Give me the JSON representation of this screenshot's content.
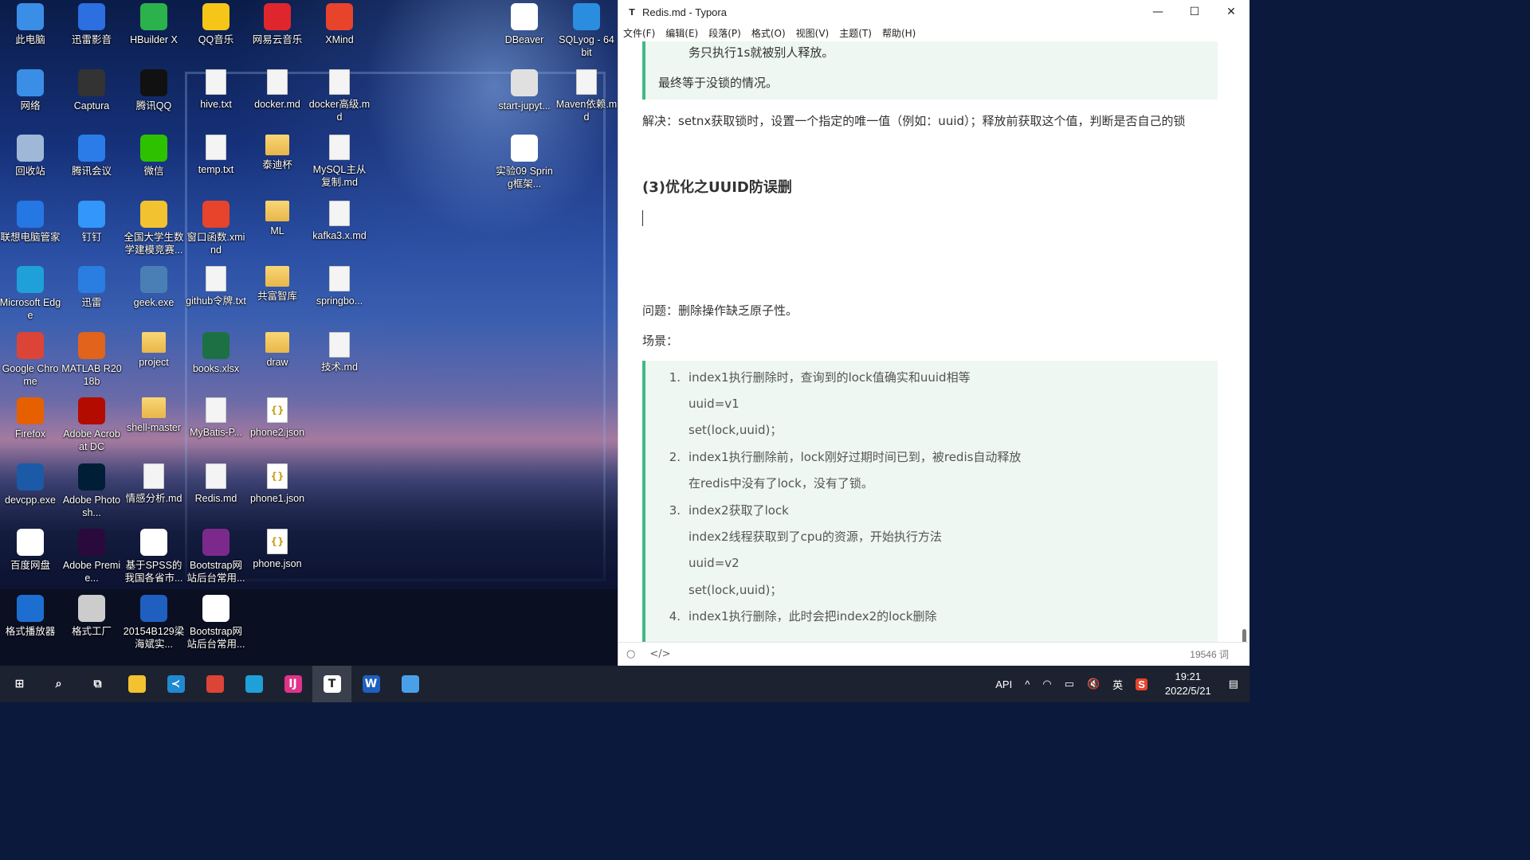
{
  "desktop_icons": [
    {
      "label": "此电脑",
      "kind": "pc-icon",
      "color": "#3a8ee6"
    },
    {
      "label": "迅雷影音",
      "kind": "player-icon",
      "color": "#2b6fe0"
    },
    {
      "label": "HBuilder X",
      "kind": "hbuilder-icon",
      "color": "#2bb24c"
    },
    {
      "label": "QQ音乐",
      "kind": "qqmusic-icon",
      "color": "#f5c518"
    },
    {
      "label": "网易云音乐",
      "kind": "netease-icon",
      "color": "#e0262d"
    },
    {
      "label": "XMind",
      "kind": "xmind-icon",
      "color": "#e8432b"
    },
    {
      "label": "DBeaver",
      "kind": "dbeaver-icon",
      "color": "#ffffff"
    },
    {
      "label": "SQLyog - 64 bit",
      "kind": "sqlyog-icon",
      "color": "#2b8de0"
    },
    {
      "label": "网络",
      "kind": "network-icon",
      "color": "#3a8ee6"
    },
    {
      "label": "Captura",
      "kind": "captura-icon",
      "color": "#333333"
    },
    {
      "label": "腾讯QQ",
      "kind": "qq-icon",
      "color": "#111111"
    },
    {
      "label": "hive.txt",
      "kind": "file-icon",
      "color": "#f4f4f4"
    },
    {
      "label": "docker.md",
      "kind": "file-icon",
      "color": "#f4f4f4"
    },
    {
      "label": "docker高级.md",
      "kind": "file-icon",
      "color": "#f4f4f4"
    },
    {
      "label": "start-jupyt...",
      "kind": "gear-file-icon",
      "color": "#e0e0e0"
    },
    {
      "label": "Maven依赖.md",
      "kind": "file-icon",
      "color": "#f4f4f4"
    },
    {
      "label": "回收站",
      "kind": "recycle-icon",
      "color": "#9fb8d8"
    },
    {
      "label": "腾讯会议",
      "kind": "meeting-icon",
      "color": "#2b7ce9"
    },
    {
      "label": "微信",
      "kind": "wechat-icon",
      "color": "#2dc100"
    },
    {
      "label": "temp.txt",
      "kind": "file-icon",
      "color": "#f4f4f4"
    },
    {
      "label": "泰迪杯",
      "kind": "folder-icon",
      "color": "#f0c55a"
    },
    {
      "label": "MySQL主从复制.md",
      "kind": "file-icon",
      "color": "#f4f4f4"
    },
    {
      "label": "实验09 Spring框架...",
      "kind": "doc-icon",
      "color": "#ffffff"
    },
    {
      "label": "联想电脑管家",
      "kind": "lenovo-icon",
      "color": "#2577e3"
    },
    {
      "label": "钉钉",
      "kind": "dingtalk-icon",
      "color": "#3296fa"
    },
    {
      "label": "全国大学生数学建模竞赛...",
      "kind": "contest-icon",
      "color": "#f2c230"
    },
    {
      "label": "窗口函数.xmind",
      "kind": "xmind-icon",
      "color": "#e8432b"
    },
    {
      "label": "ML",
      "kind": "folder-icon",
      "color": "#f0c55a"
    },
    {
      "label": "kafka3.x.md",
      "kind": "file-icon",
      "color": "#f4f4f4"
    },
    {
      "label": "Microsoft Edge",
      "kind": "edge-icon",
      "color": "#1fa0d8"
    },
    {
      "label": "迅雷",
      "kind": "thunder-icon",
      "color": "#2a7de1"
    },
    {
      "label": "geek.exe",
      "kind": "geek-icon",
      "color": "#4a7fb5"
    },
    {
      "label": "github令牌.txt",
      "kind": "file-icon",
      "color": "#f4f4f4"
    },
    {
      "label": "共富智库",
      "kind": "folder-icon",
      "color": "#f0c55a"
    },
    {
      "label": "springbo...",
      "kind": "file-icon",
      "color": "#f4f4f4"
    },
    {
      "label": "Google Chrome",
      "kind": "chrome-icon",
      "color": "#db4437"
    },
    {
      "label": "MATLAB R2018b",
      "kind": "matlab-icon",
      "color": "#e2631b"
    },
    {
      "label": "project",
      "kind": "folder-icon",
      "color": "#f0c55a"
    },
    {
      "label": "books.xlsx",
      "kind": "excel-icon",
      "color": "#1d7044"
    },
    {
      "label": "draw",
      "kind": "folder-icon",
      "color": "#f0c55a"
    },
    {
      "label": "技术.md",
      "kind": "file-icon",
      "color": "#f4f4f4"
    },
    {
      "label": "Firefox",
      "kind": "firefox-icon",
      "color": "#e66000"
    },
    {
      "label": "Adobe Acrobat DC",
      "kind": "acrobat-icon",
      "color": "#b30b00"
    },
    {
      "label": "shell-master",
      "kind": "folder-icon",
      "color": "#f0c55a"
    },
    {
      "label": "MyBatis-P...",
      "kind": "file-icon",
      "color": "#f4f4f4"
    },
    {
      "label": "phone2.json",
      "kind": "json-icon",
      "color": "#ffffff"
    },
    {
      "label": "devcpp.exe",
      "kind": "devcpp-icon",
      "color": "#1b5aa6"
    },
    {
      "label": "Adobe Photosh...",
      "kind": "photoshop-icon",
      "color": "#001e36"
    },
    {
      "label": "情感分析.md",
      "kind": "file-icon",
      "color": "#f4f4f4"
    },
    {
      "label": "Redis.md",
      "kind": "file-icon",
      "color": "#f4f4f4"
    },
    {
      "label": "phone1.json",
      "kind": "json-icon",
      "color": "#ffffff"
    },
    {
      "label": "百度网盘",
      "kind": "baidupan-icon",
      "color": "#ffffff"
    },
    {
      "label": "Adobe Premie...",
      "kind": "premiere-icon",
      "color": "#2a0a3c"
    },
    {
      "label": "基于SPSS的我国各省市...",
      "kind": "pdf-icon",
      "color": "#ffffff"
    },
    {
      "label": "Bootstrap网站后台常用...",
      "kind": "winrar-icon",
      "color": "#7b2a8c"
    },
    {
      "label": "phone.json",
      "kind": "json-icon",
      "color": "#ffffff"
    },
    {
      "label": "格式播放器",
      "kind": "video-player-icon",
      "color": "#1c6fd1"
    },
    {
      "label": "格式工厂",
      "kind": "format-factory-icon",
      "color": "#cccccc"
    },
    {
      "label": "20154B129梁海斌实...",
      "kind": "word-icon",
      "color": "#1f5fbf"
    },
    {
      "label": "Bootstrap网站后台常用...",
      "kind": "chrome-html-icon",
      "color": "#ffffff"
    }
  ],
  "typora": {
    "title": "Redis.md - Typora",
    "title_icon": "T",
    "controls": {
      "minimize": "—",
      "maximize": "☐",
      "close": "✕"
    },
    "menu": [
      "文件(F)",
      "编辑(E)",
      "段落(P)",
      "格式(O)",
      "视图(V)",
      "主题(T)",
      "帮助(H)"
    ],
    "doc": {
      "quote_line1": "务只执行1s就被别人释放。",
      "quote_line2": "最终等于没锁的情况。",
      "solution": "解决：setnx获取锁时，设置一个指定的唯一值（例如：uuid）；释放前获取这个值，判断是否自己的锁",
      "heading": "(3)优化之UUID防误删",
      "problem": "问题：删除操作缺乏原子性。",
      "scene": "场景：",
      "list": [
        {
          "num": "1.",
          "text": "index1执行删除时，查询到的lock值确实和uuid相等"
        },
        {
          "num": "",
          "text": "uuid=v1"
        },
        {
          "num": "",
          "text": "set(lock,uuid)；"
        },
        {
          "num": "2.",
          "text": "index1执行删除前，lock刚好过期时间已到，被redis自动释放"
        },
        {
          "num": "",
          "text": "在redis中没有了lock，没有了锁。"
        },
        {
          "num": "3.",
          "text": "index2获取了lock"
        },
        {
          "num": "",
          "text": "index2线程获取到了cpu的资源，开始执行方法"
        },
        {
          "num": "",
          "text": "uuid=v2"
        },
        {
          "num": "",
          "text": "set(lock,uuid)；"
        },
        {
          "num": "4.",
          "text": "index1执行删除，此时会把index2的lock删除"
        }
      ]
    },
    "status": {
      "outline_icon": "○",
      "source_icon": "</>",
      "word_count": "19546 词"
    }
  },
  "taskbar": {
    "apps": [
      {
        "name": "start-button",
        "glyph": "⊞",
        "color": "#1d2230"
      },
      {
        "name": "search-icon",
        "glyph": "⌕",
        "color": "#1d2230"
      },
      {
        "name": "task-view-icon",
        "glyph": "⧉",
        "color": "#1d2230"
      },
      {
        "name": "explorer-icon",
        "glyph": "",
        "color": "#f2c230"
      },
      {
        "name": "vscode-icon",
        "glyph": "≺",
        "color": "#1f8ad2"
      },
      {
        "name": "chrome-icon",
        "glyph": "",
        "color": "#db4437"
      },
      {
        "name": "edge-icon",
        "glyph": "",
        "color": "#1fa0d8"
      },
      {
        "name": "intellij-icon",
        "glyph": "IJ",
        "color": "#e0338a"
      },
      {
        "name": "typora-icon",
        "glyph": "T",
        "color": "#ffffff"
      },
      {
        "name": "word-icon",
        "glyph": "W",
        "color": "#1f5fbf"
      },
      {
        "name": "remote-desktop-icon",
        "glyph": "",
        "color": "#4aa0e8"
      }
    ],
    "tray": {
      "api": "API",
      "overflow": "^",
      "ime": "英",
      "time": "19:21",
      "date": "2022/5/21"
    }
  }
}
